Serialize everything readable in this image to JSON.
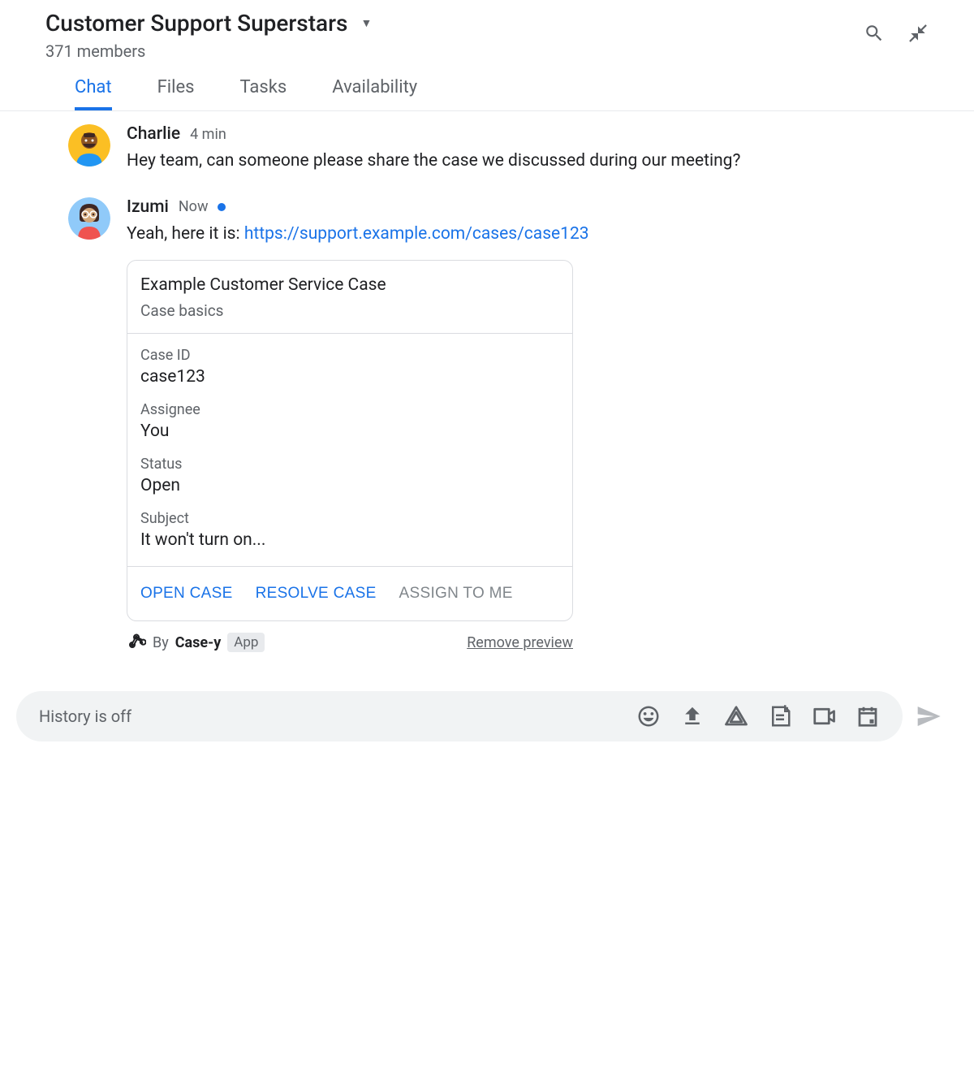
{
  "header": {
    "title": "Customer Support Superstars",
    "members": "371 members"
  },
  "tabs": [
    {
      "label": "Chat",
      "active": true
    },
    {
      "label": "Files",
      "active": false
    },
    {
      "label": "Tasks",
      "active": false
    },
    {
      "label": "Availability",
      "active": false
    }
  ],
  "messages": [
    {
      "author": "Charlie",
      "time": "4 min",
      "text": "Hey team, can someone please share the case we discussed during our meeting?",
      "avatar_bg": "#fbbf24",
      "hasStatus": false
    },
    {
      "author": "Izumi",
      "time": "Now",
      "text_prefix": "Yeah, here it is: ",
      "link_text": "https://support.example.com/cases/case123",
      "avatar_bg": "#e57373",
      "hasStatus": true
    }
  ],
  "card": {
    "title": "Example Customer Service Case",
    "subtitle": "Case basics",
    "fields": [
      {
        "label": "Case ID",
        "value": "case123"
      },
      {
        "label": "Assignee",
        "value": "You"
      },
      {
        "label": "Status",
        "value": "Open"
      },
      {
        "label": "Subject",
        "value": "It won't turn on..."
      }
    ],
    "actions": [
      {
        "label": "OPEN CASE",
        "disabled": false
      },
      {
        "label": "RESOLVE CASE",
        "disabled": false
      },
      {
        "label": "ASSIGN TO ME",
        "disabled": true
      }
    ],
    "attribution_prefix": "By ",
    "attribution_name": "Case-y",
    "attribution_badge": "App",
    "remove_label": "Remove preview"
  },
  "composer": {
    "placeholder": "History is off"
  }
}
